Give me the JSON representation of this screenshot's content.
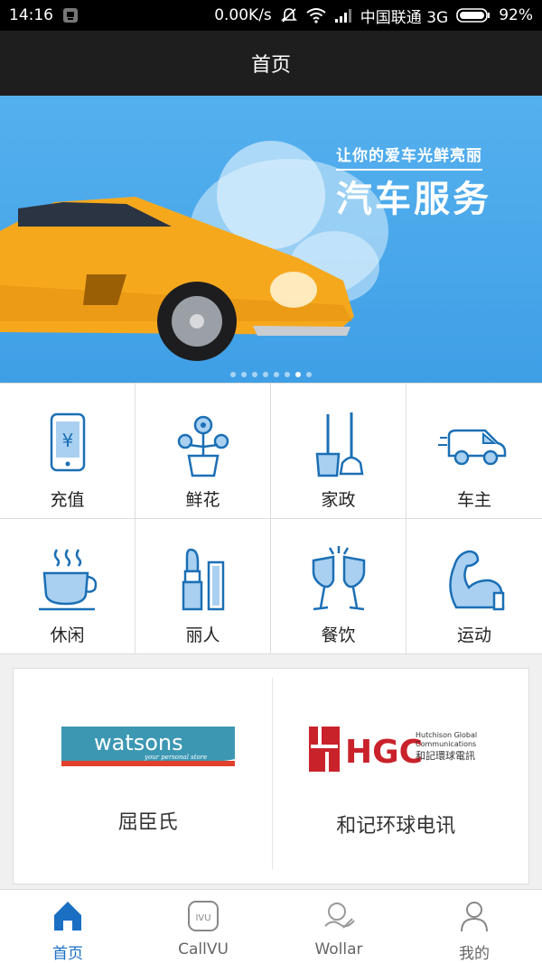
{
  "status": {
    "time": "14:16",
    "speed": "0.00K/s",
    "carrier": "中国联通 3G",
    "battery": "92%"
  },
  "header": {
    "title": "首页"
  },
  "banner": {
    "subtitle": "让你的爱车光鲜亮丽",
    "title": "汽车服务",
    "slide_count": 8,
    "active_slide": 6
  },
  "categories": [
    {
      "label": "充值",
      "icon": "phone-recharge-icon"
    },
    {
      "label": "鲜花",
      "icon": "flower-pot-icon"
    },
    {
      "label": "家政",
      "icon": "broom-mop-icon"
    },
    {
      "label": "车主",
      "icon": "car-icon"
    },
    {
      "label": "休闲",
      "icon": "coffee-cup-icon"
    },
    {
      "label": "丽人",
      "icon": "lipstick-icon"
    },
    {
      "label": "餐饮",
      "icon": "champagne-glasses-icon"
    },
    {
      "label": "运动",
      "icon": "muscle-arm-icon"
    }
  ],
  "brands": [
    {
      "name": "屈臣氏",
      "logo_text": "watsons",
      "logo_tagline": "your personal store"
    },
    {
      "name": "和记环球电讯",
      "logo_text": "HGC",
      "logo_line1": "Hutchison Global",
      "logo_line2": "Communications",
      "logo_line3": "和記環球電訊"
    }
  ],
  "tabs": [
    {
      "label": "首页",
      "icon": "home-icon",
      "active": true
    },
    {
      "label": "CallVU",
      "icon": "callvu-icon",
      "active": false
    },
    {
      "label": "Wollar",
      "icon": "wollar-icon",
      "active": false
    },
    {
      "label": "我的",
      "icon": "user-icon",
      "active": false
    }
  ],
  "colors": {
    "accent": "#1a6fc3",
    "banner": "#4aa7ea",
    "icon_stroke": "#1b6fb5",
    "icon_fill": "#a9d0f0"
  }
}
